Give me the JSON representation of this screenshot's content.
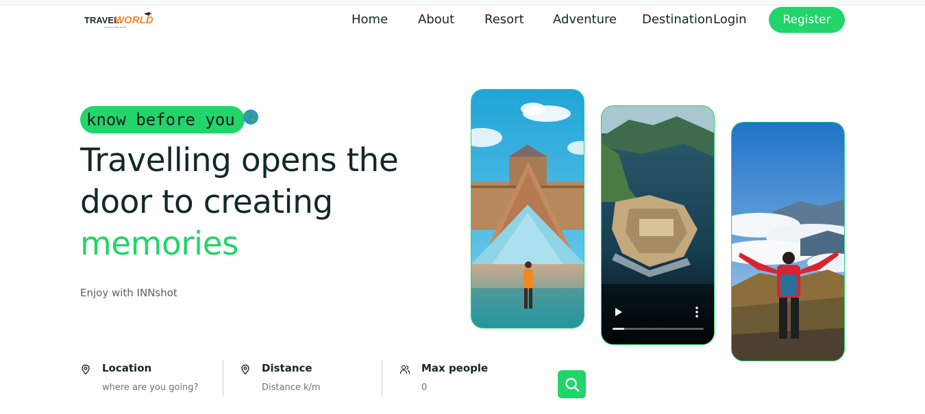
{
  "brand": {
    "logo_main": "TRAVEL",
    "logo_accent": "WORLD",
    "logo_tagline": "explore new world"
  },
  "nav": {
    "home": "Home",
    "about": "About",
    "resort": "Resort",
    "adventure": "Adventure",
    "destination": "Destination",
    "login": "Login",
    "register": "Register"
  },
  "hero": {
    "tag": "know before you",
    "headline_1": "Travelling opens the",
    "headline_2": "door to creating",
    "headline_accent": "memories",
    "subtitle": "Enjoy with INNshot"
  },
  "search": {
    "location_label": "Location",
    "location_placeholder": "where are you going?",
    "distance_label": "Distance",
    "distance_placeholder": "Distance k/m",
    "people_label": "Max people",
    "people_placeholder": "0"
  },
  "colors": {
    "accent": "#21d56a",
    "text": "#12282a"
  },
  "icons": [
    "map-pin-icon",
    "map-pin-icon",
    "users-icon",
    "search-icon",
    "globe-icon",
    "play-icon",
    "more-vertical-icon"
  ],
  "video": {
    "progress": 0.13
  }
}
